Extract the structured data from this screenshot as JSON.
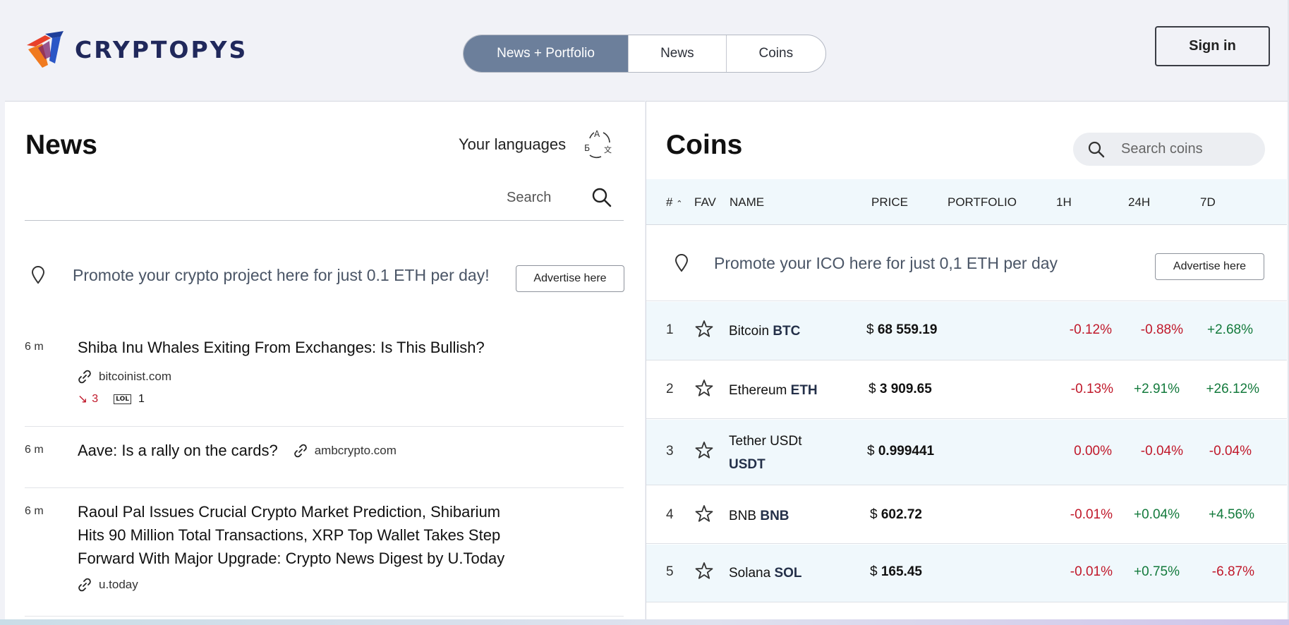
{
  "brand": {
    "name": "CRYPTOPYS"
  },
  "nav": {
    "tabs": [
      {
        "label": "News + Portfolio",
        "active": true
      },
      {
        "label": "News",
        "active": false
      },
      {
        "label": "Coins",
        "active": false
      }
    ],
    "signin_label": "Sign in"
  },
  "news": {
    "title": "News",
    "languages_label": "Your languages",
    "search_label": "Search",
    "promo": {
      "text": "Promote your crypto project here for just 0.1 ETH per day!",
      "button": "Advertise here"
    },
    "items": [
      {
        "time": "6 m",
        "title": "Shiba Inu Whales Exiting From Exchanges: Is This Bullish?",
        "source": "bitcoinist.com",
        "downvotes": "3",
        "lol": "1"
      },
      {
        "time": "6 m",
        "title": "Aave: Is a rally on the cards?",
        "source": "ambcrypto.com"
      },
      {
        "time": "6 m",
        "title_lines": [
          "Raoul Pal Issues Crucial Crypto Market Prediction, Shibarium",
          "Hits 90 Million Total Transactions, XRP Top Wallet Takes Step",
          "Forward With Major Upgrade: Crypto News Digest by U.Today"
        ],
        "source": "u.today"
      }
    ],
    "lol_badge": "LOL"
  },
  "coins": {
    "title": "Coins",
    "search_placeholder": "Search coins",
    "columns": {
      "rank": "#",
      "fav": "FAV",
      "name": "NAME",
      "price": "PRICE",
      "portfolio": "PORTFOLIO",
      "h1": "1H",
      "h24": "24H",
      "d7": "7D"
    },
    "promo": {
      "text": "Promote your ICO here for just 0,1 ETH per day",
      "button": "Advertise here"
    },
    "currency_symbol": "$",
    "rows": [
      {
        "rank": "1",
        "name": "Bitcoin",
        "symbol": "BTC",
        "price": "68 559.19",
        "h1": "-0.12%",
        "h24": "-0.88%",
        "d7": "+2.68%"
      },
      {
        "rank": "2",
        "name": "Ethereum",
        "symbol": "ETH",
        "price": "3 909.65",
        "h1": "-0.13%",
        "h24": "+2.91%",
        "d7": "+26.12%"
      },
      {
        "rank": "3",
        "name": "Tether USDt",
        "symbol": "USDT",
        "price": "0.999441",
        "h1": "0.00%",
        "h24": "-0.04%",
        "d7": "-0.04%"
      },
      {
        "rank": "4",
        "name": "BNB",
        "symbol": "BNB",
        "price": "602.72",
        "h1": "-0.01%",
        "h24": "+0.04%",
        "d7": "+4.56%"
      },
      {
        "rank": "5",
        "name": "Solana",
        "symbol": "SOL",
        "price": "165.45",
        "h1": "-0.01%",
        "h24": "+0.75%",
        "d7": "-6.87%"
      }
    ]
  },
  "colors": {
    "active_tab": "#6c7f9b",
    "negative": "#c0182a",
    "positive": "#137a3c",
    "brand_text": "#20285b"
  }
}
